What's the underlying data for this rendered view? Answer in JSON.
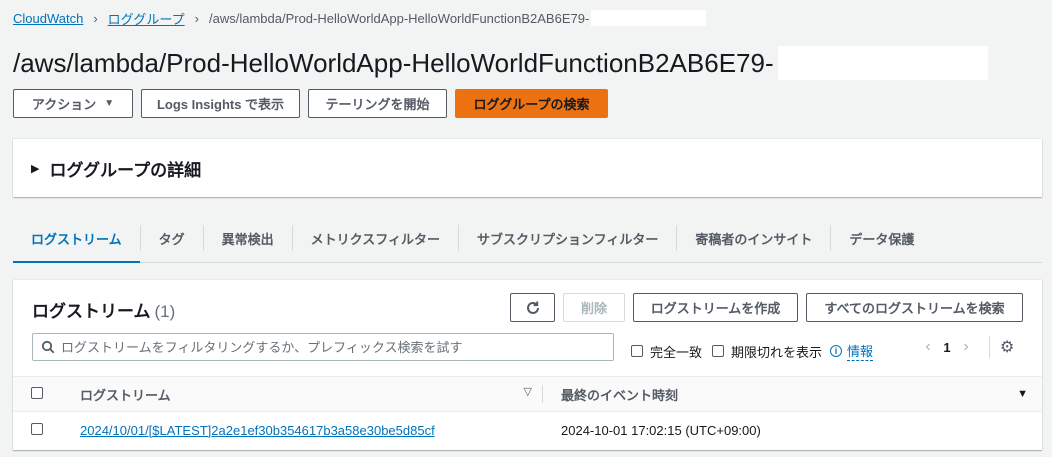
{
  "breadcrumb": {
    "items": [
      "CloudWatch",
      "ロググループ"
    ],
    "current": "/aws/lambda/Prod-HelloWorldApp-HelloWorldFunctionB2AB6E79-"
  },
  "page": {
    "title": "/aws/lambda/Prod-HelloWorldApp-HelloWorldFunctionB2AB6E79-"
  },
  "actions": {
    "action_label": "アクション",
    "logs_insights_label": "Logs Insights で表示",
    "tailing_label": "テーリングを開始",
    "search_log_group_label": "ロググループの検索"
  },
  "details": {
    "label": "ロググループの詳細"
  },
  "tabs": [
    {
      "label": "ログストリーム",
      "active": true
    },
    {
      "label": "タグ"
    },
    {
      "label": "異常検出"
    },
    {
      "label": "メトリクスフィルター"
    },
    {
      "label": "サブスクリプションフィルター"
    },
    {
      "label": "寄稿者のインサイト"
    },
    {
      "label": "データ保護"
    }
  ],
  "log_streams": {
    "title": "ログストリーム",
    "count": "(1)",
    "delete_label": "削除",
    "create_label": "ログストリームを作成",
    "search_all_label": "すべてのログストリームを検索",
    "search_placeholder": "ログストリームをフィルタリングするか、プレフィックス検索を試す",
    "exact_match_label": "完全一致",
    "show_expired_label": "期限切れを表示",
    "info_label": "情報",
    "page_number": "1",
    "columns": [
      "ログストリーム",
      "最終のイベント時刻"
    ],
    "rows": [
      {
        "name": "2024/10/01/[$LATEST]2a2e1ef30b354617b3a58e30be5d85cf",
        "last_event": "2024-10-01 17:02:15 (UTC+09:00)"
      }
    ]
  },
  "colors": {
    "link": "#0073bb",
    "primary": "#ec7211",
    "background": "#f2f3f3"
  }
}
